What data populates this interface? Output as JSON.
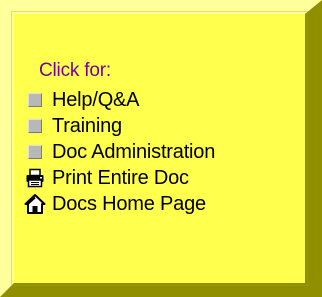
{
  "panel": {
    "heading": "Click for:",
    "items": [
      {
        "label": "Help/Q&A",
        "icon": "square-bullet-icon"
      },
      {
        "label": "Training",
        "icon": "square-bullet-icon"
      },
      {
        "label": "Doc Administration",
        "icon": "square-bullet-icon"
      },
      {
        "label": "Print Entire Doc",
        "icon": "printer-icon"
      },
      {
        "label": "Docs Home Page",
        "icon": "home-icon"
      }
    ]
  },
  "colors": {
    "panel_background": "#ffff4d",
    "heading_text": "#7a0099",
    "item_text": "#000000",
    "bullet_square": "#b8b8b8"
  }
}
